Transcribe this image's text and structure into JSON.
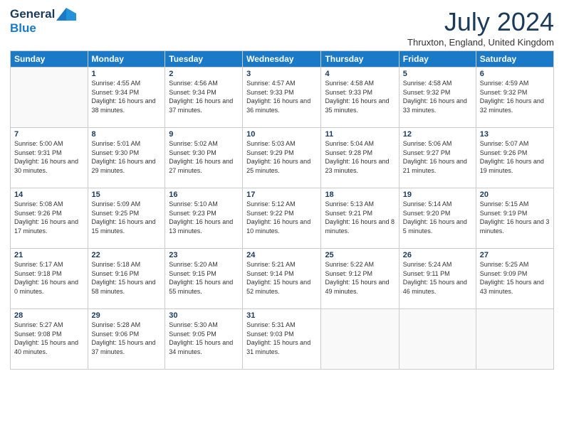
{
  "header": {
    "logo_general": "General",
    "logo_blue": "Blue",
    "title": "July 2024",
    "location": "Thruxton, England, United Kingdom"
  },
  "days_of_week": [
    "Sunday",
    "Monday",
    "Tuesday",
    "Wednesday",
    "Thursday",
    "Friday",
    "Saturday"
  ],
  "weeks": [
    [
      {
        "day": "",
        "sunrise": "",
        "sunset": "",
        "daylight": ""
      },
      {
        "day": "1",
        "sunrise": "Sunrise: 4:55 AM",
        "sunset": "Sunset: 9:34 PM",
        "daylight": "Daylight: 16 hours and 38 minutes."
      },
      {
        "day": "2",
        "sunrise": "Sunrise: 4:56 AM",
        "sunset": "Sunset: 9:34 PM",
        "daylight": "Daylight: 16 hours and 37 minutes."
      },
      {
        "day": "3",
        "sunrise": "Sunrise: 4:57 AM",
        "sunset": "Sunset: 9:33 PM",
        "daylight": "Daylight: 16 hours and 36 minutes."
      },
      {
        "day": "4",
        "sunrise": "Sunrise: 4:58 AM",
        "sunset": "Sunset: 9:33 PM",
        "daylight": "Daylight: 16 hours and 35 minutes."
      },
      {
        "day": "5",
        "sunrise": "Sunrise: 4:58 AM",
        "sunset": "Sunset: 9:32 PM",
        "daylight": "Daylight: 16 hours and 33 minutes."
      },
      {
        "day": "6",
        "sunrise": "Sunrise: 4:59 AM",
        "sunset": "Sunset: 9:32 PM",
        "daylight": "Daylight: 16 hours and 32 minutes."
      }
    ],
    [
      {
        "day": "7",
        "sunrise": "Sunrise: 5:00 AM",
        "sunset": "Sunset: 9:31 PM",
        "daylight": "Daylight: 16 hours and 30 minutes."
      },
      {
        "day": "8",
        "sunrise": "Sunrise: 5:01 AM",
        "sunset": "Sunset: 9:30 PM",
        "daylight": "Daylight: 16 hours and 29 minutes."
      },
      {
        "day": "9",
        "sunrise": "Sunrise: 5:02 AM",
        "sunset": "Sunset: 9:30 PM",
        "daylight": "Daylight: 16 hours and 27 minutes."
      },
      {
        "day": "10",
        "sunrise": "Sunrise: 5:03 AM",
        "sunset": "Sunset: 9:29 PM",
        "daylight": "Daylight: 16 hours and 25 minutes."
      },
      {
        "day": "11",
        "sunrise": "Sunrise: 5:04 AM",
        "sunset": "Sunset: 9:28 PM",
        "daylight": "Daylight: 16 hours and 23 minutes."
      },
      {
        "day": "12",
        "sunrise": "Sunrise: 5:06 AM",
        "sunset": "Sunset: 9:27 PM",
        "daylight": "Daylight: 16 hours and 21 minutes."
      },
      {
        "day": "13",
        "sunrise": "Sunrise: 5:07 AM",
        "sunset": "Sunset: 9:26 PM",
        "daylight": "Daylight: 16 hours and 19 minutes."
      }
    ],
    [
      {
        "day": "14",
        "sunrise": "Sunrise: 5:08 AM",
        "sunset": "Sunset: 9:26 PM",
        "daylight": "Daylight: 16 hours and 17 minutes."
      },
      {
        "day": "15",
        "sunrise": "Sunrise: 5:09 AM",
        "sunset": "Sunset: 9:25 PM",
        "daylight": "Daylight: 16 hours and 15 minutes."
      },
      {
        "day": "16",
        "sunrise": "Sunrise: 5:10 AM",
        "sunset": "Sunset: 9:23 PM",
        "daylight": "Daylight: 16 hours and 13 minutes."
      },
      {
        "day": "17",
        "sunrise": "Sunrise: 5:12 AM",
        "sunset": "Sunset: 9:22 PM",
        "daylight": "Daylight: 16 hours and 10 minutes."
      },
      {
        "day": "18",
        "sunrise": "Sunrise: 5:13 AM",
        "sunset": "Sunset: 9:21 PM",
        "daylight": "Daylight: 16 hours and 8 minutes."
      },
      {
        "day": "19",
        "sunrise": "Sunrise: 5:14 AM",
        "sunset": "Sunset: 9:20 PM",
        "daylight": "Daylight: 16 hours and 5 minutes."
      },
      {
        "day": "20",
        "sunrise": "Sunrise: 5:15 AM",
        "sunset": "Sunset: 9:19 PM",
        "daylight": "Daylight: 16 hours and 3 minutes."
      }
    ],
    [
      {
        "day": "21",
        "sunrise": "Sunrise: 5:17 AM",
        "sunset": "Sunset: 9:18 PM",
        "daylight": "Daylight: 16 hours and 0 minutes."
      },
      {
        "day": "22",
        "sunrise": "Sunrise: 5:18 AM",
        "sunset": "Sunset: 9:16 PM",
        "daylight": "Daylight: 15 hours and 58 minutes."
      },
      {
        "day": "23",
        "sunrise": "Sunrise: 5:20 AM",
        "sunset": "Sunset: 9:15 PM",
        "daylight": "Daylight: 15 hours and 55 minutes."
      },
      {
        "day": "24",
        "sunrise": "Sunrise: 5:21 AM",
        "sunset": "Sunset: 9:14 PM",
        "daylight": "Daylight: 15 hours and 52 minutes."
      },
      {
        "day": "25",
        "sunrise": "Sunrise: 5:22 AM",
        "sunset": "Sunset: 9:12 PM",
        "daylight": "Daylight: 15 hours and 49 minutes."
      },
      {
        "day": "26",
        "sunrise": "Sunrise: 5:24 AM",
        "sunset": "Sunset: 9:11 PM",
        "daylight": "Daylight: 15 hours and 46 minutes."
      },
      {
        "day": "27",
        "sunrise": "Sunrise: 5:25 AM",
        "sunset": "Sunset: 9:09 PM",
        "daylight": "Daylight: 15 hours and 43 minutes."
      }
    ],
    [
      {
        "day": "28",
        "sunrise": "Sunrise: 5:27 AM",
        "sunset": "Sunset: 9:08 PM",
        "daylight": "Daylight: 15 hours and 40 minutes."
      },
      {
        "day": "29",
        "sunrise": "Sunrise: 5:28 AM",
        "sunset": "Sunset: 9:06 PM",
        "daylight": "Daylight: 15 hours and 37 minutes."
      },
      {
        "day": "30",
        "sunrise": "Sunrise: 5:30 AM",
        "sunset": "Sunset: 9:05 PM",
        "daylight": "Daylight: 15 hours and 34 minutes."
      },
      {
        "day": "31",
        "sunrise": "Sunrise: 5:31 AM",
        "sunset": "Sunset: 9:03 PM",
        "daylight": "Daylight: 15 hours and 31 minutes."
      },
      {
        "day": "",
        "sunrise": "",
        "sunset": "",
        "daylight": ""
      },
      {
        "day": "",
        "sunrise": "",
        "sunset": "",
        "daylight": ""
      },
      {
        "day": "",
        "sunrise": "",
        "sunset": "",
        "daylight": ""
      }
    ]
  ]
}
